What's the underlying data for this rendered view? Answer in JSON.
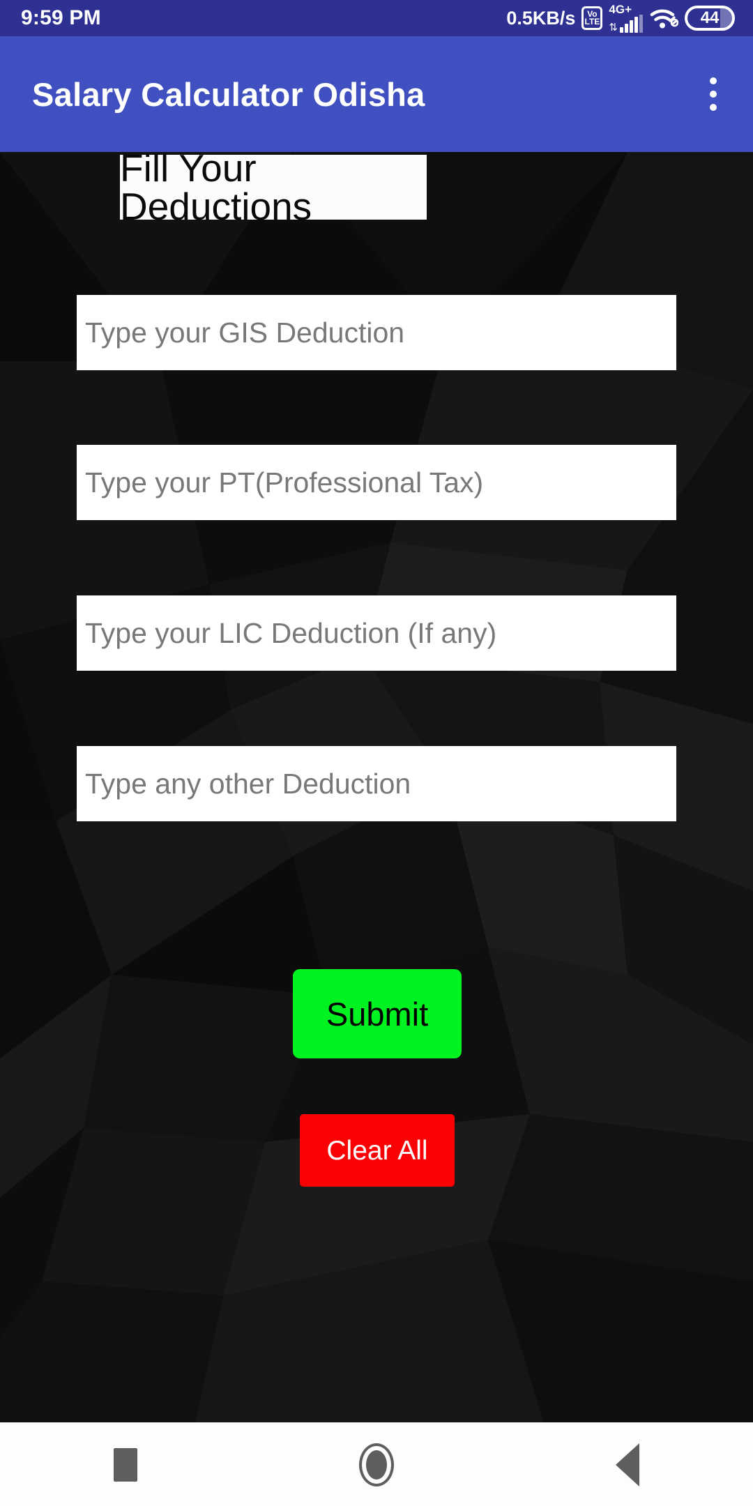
{
  "status_bar": {
    "clock": "9:59 PM",
    "network_speed": "0.5KB/s",
    "volte_top": "Vo",
    "volte_bottom": "LTE",
    "signal_label": "4G+",
    "data_arrows": "⇅",
    "battery_level": "44",
    "icons": [
      "volte-icon",
      "signal-bars-icon",
      "wifi-icon",
      "battery-icon"
    ]
  },
  "app_bar": {
    "title": "Salary Calculator Odisha",
    "overflow_menu": "overflow-menu-icon",
    "background_color": "#4050c0"
  },
  "main": {
    "heading": "Fill Your Deductions",
    "fields": [
      {
        "name": "gis-deduction",
        "placeholder": "Type your GIS Deduction",
        "value": ""
      },
      {
        "name": "professional-tax",
        "placeholder": "Type your PT(Professional Tax)",
        "value": ""
      },
      {
        "name": "lic-deduction",
        "placeholder": "Type your LIC Deduction (If any)",
        "value": ""
      },
      {
        "name": "other-deduction",
        "placeholder": "Type any other Deduction",
        "value": ""
      }
    ],
    "submit_label": "Submit",
    "clear_label": "Clear All",
    "submit_color": "#00f221",
    "clear_color": "#fb0104"
  },
  "nav_bar": {
    "recents": "square-icon",
    "home": "circle-icon",
    "back": "triangle-back-icon"
  }
}
